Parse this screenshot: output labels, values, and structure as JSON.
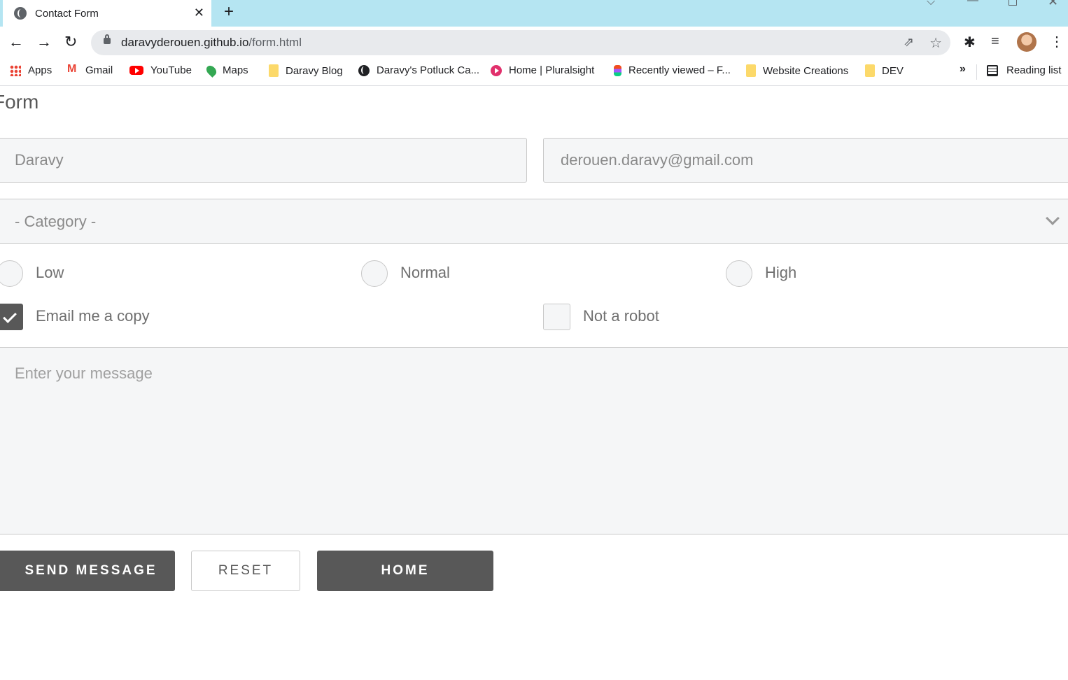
{
  "browser": {
    "tab_title": "Contact Form",
    "tab_close": "✕",
    "new_tab": "+",
    "url_host": "daravyderouen.github.io",
    "url_path": "/form.html",
    "bookmarks": [
      {
        "label": "Apps",
        "icon": "apps-icon"
      },
      {
        "label": "Gmail",
        "icon": "gmail-icon"
      },
      {
        "label": "YouTube",
        "icon": "youtube-icon"
      },
      {
        "label": "Maps",
        "icon": "maps-icon"
      },
      {
        "label": "Daravy Blog",
        "icon": "folder-icon"
      },
      {
        "label": "Daravy's Potluck Ca...",
        "icon": "globe-icon"
      },
      {
        "label": "Home | Pluralsight",
        "icon": "pluralsight-icon"
      },
      {
        "label": "Recently viewed – F...",
        "icon": "figma-icon"
      },
      {
        "label": "Website Creations",
        "icon": "folder-icon"
      },
      {
        "label": "DEV",
        "icon": "folder-icon"
      }
    ],
    "more_bookmarks": "»",
    "reading_list": "Reading list"
  },
  "form": {
    "title": "Form",
    "name_value": "Daravy",
    "email_value": "derouen.daravy@gmail.com",
    "category_value": "- Category -",
    "priority_options": [
      "Low",
      "Normal",
      "High"
    ],
    "email_copy_label": "Email me a copy",
    "email_copy_checked": true,
    "not_robot_label": "Not a robot",
    "not_robot_checked": false,
    "message_placeholder": "Enter your message",
    "send_label": "SEND MESSAGE",
    "reset_label": "RESET",
    "home_label": "HOME"
  },
  "colors": {
    "tabstrip": "#b5e5f2",
    "button_dark": "#585858",
    "field_bg": "#f5f6f7"
  }
}
